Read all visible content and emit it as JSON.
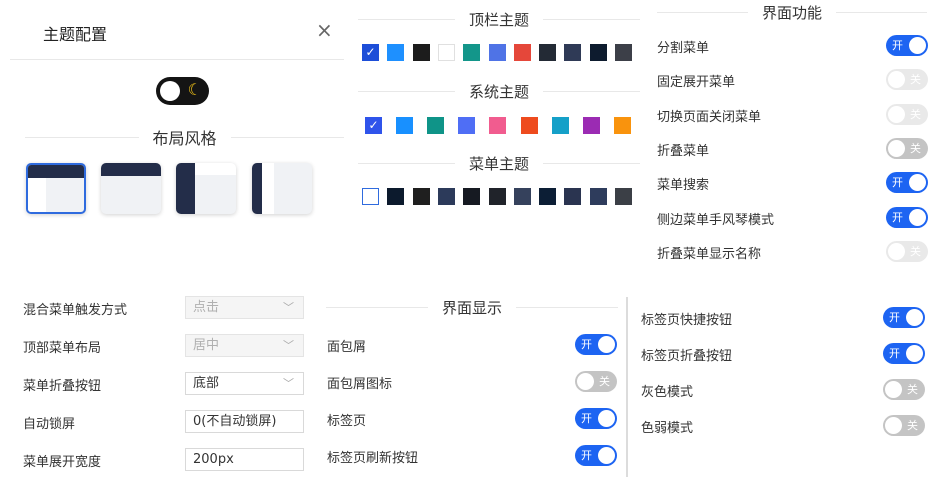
{
  "header": {
    "title": "主题配置",
    "close_icon": "×"
  },
  "dark_mode": {
    "icon": "moon-icon",
    "moon_glyph": "☾"
  },
  "layout": {
    "section_title": "布局风格"
  },
  "topbar_theme": {
    "title": "顶栏主题",
    "swatches": [
      "#1d4ed8",
      "#1e90ff",
      "#1c1c1c",
      "#ffffff",
      "#13968a",
      "#4f73e6",
      "#e5473a",
      "#232a35",
      "#2f3a56",
      "#0d1b2e",
      "#3c3f48"
    ]
  },
  "system_theme": {
    "title": "系统主题",
    "swatches": [
      "#2f54eb",
      "#1890ff",
      "#0f9488",
      "#4f6ef5",
      "#f15c8f",
      "#ee4b1e",
      "#15a0c8",
      "#9b2bb3",
      "#f9930d"
    ]
  },
  "menu_theme": {
    "title": "菜单主题",
    "swatches": [
      "#ffffff",
      "#0c1a2d",
      "#1f1f1f",
      "#2c3a5a",
      "#161a22",
      "#20232a",
      "#35415c",
      "#0c1e35",
      "#2a3450",
      "#2e3c5c",
      "#3b3f46"
    ]
  },
  "interface_functions": {
    "title": "界面功能",
    "items": [
      {
        "label": "分割菜单",
        "on": true,
        "text": "开"
      },
      {
        "label": "固定展开菜单",
        "on": false,
        "text": "关",
        "faint": true
      },
      {
        "label": "切换页面关闭菜单",
        "on": false,
        "text": "关",
        "faint": true
      },
      {
        "label": "折叠菜单",
        "on": false,
        "text": "关"
      },
      {
        "label": "菜单搜索",
        "on": true,
        "text": "开"
      },
      {
        "label": "侧边菜单手风琴模式",
        "on": true,
        "text": "开"
      },
      {
        "label": "折叠菜单显示名称",
        "on": false,
        "text": "关",
        "faint": true
      }
    ]
  },
  "settings": {
    "items": [
      {
        "label": "混合菜单触发方式",
        "value": "点击",
        "type": "select",
        "disabled": true
      },
      {
        "label": "顶部菜单布局",
        "value": "居中",
        "type": "select",
        "disabled": true
      },
      {
        "label": "菜单折叠按钮",
        "value": "底部",
        "type": "select",
        "disabled": false
      },
      {
        "label": "自动锁屏",
        "value": "0(不自动锁屏)",
        "type": "input"
      },
      {
        "label": "菜单展开宽度",
        "value": "200px",
        "type": "input"
      }
    ]
  },
  "interface_display": {
    "title": "界面显示",
    "items": [
      {
        "label": "面包屑",
        "on": true,
        "text": "开"
      },
      {
        "label": "面包屑图标",
        "on": false,
        "text": "关"
      },
      {
        "label": "标签页",
        "on": true,
        "text": "开"
      },
      {
        "label": "标签页刷新按钮",
        "on": true,
        "text": "开"
      }
    ]
  },
  "tab_settings": {
    "items": [
      {
        "label": "标签页快捷按钮",
        "on": true,
        "text": "开"
      },
      {
        "label": "标签页折叠按钮",
        "on": true,
        "text": "开"
      },
      {
        "label": "灰色模式",
        "on": false,
        "text": "关"
      },
      {
        "label": "色弱模式",
        "on": false,
        "text": "关"
      }
    ]
  },
  "colors": {
    "accent": "#1d64f2",
    "dark": "#232d49"
  }
}
